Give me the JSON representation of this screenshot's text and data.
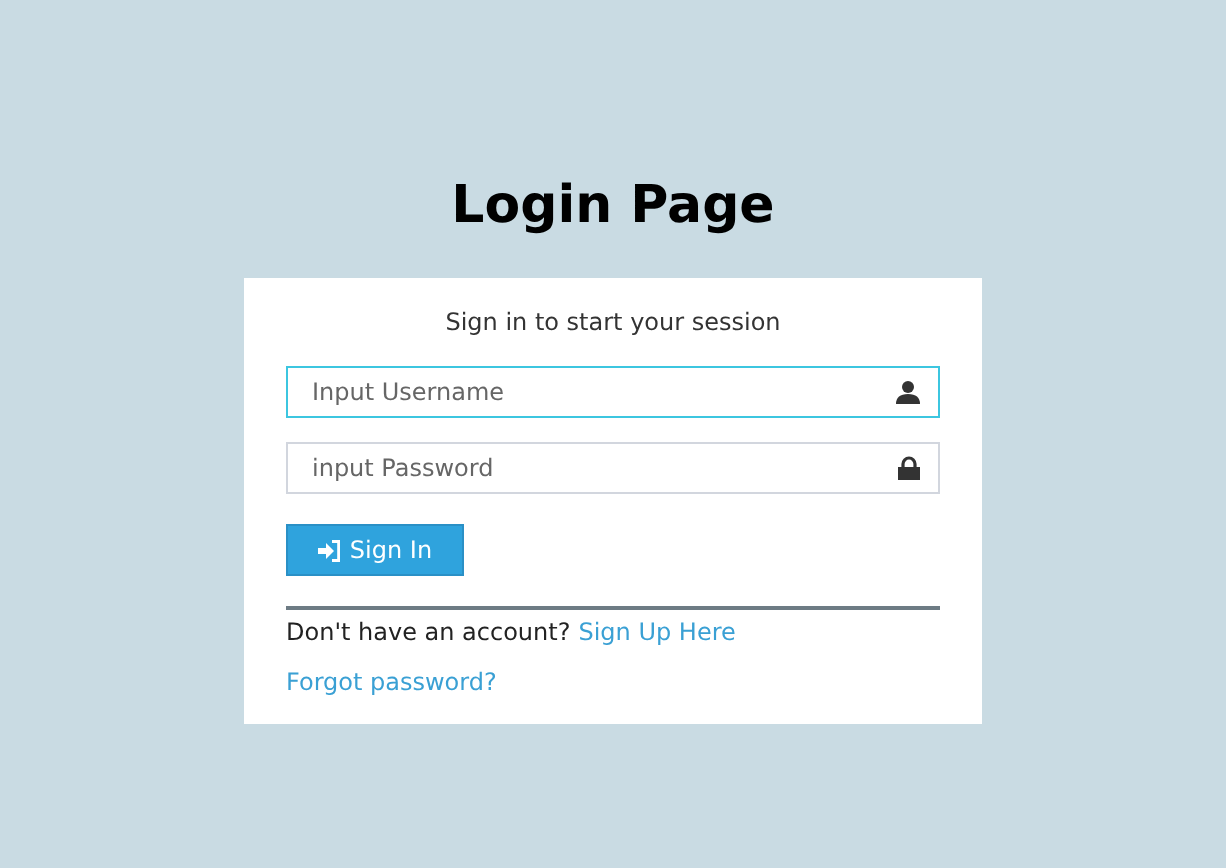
{
  "title": "Login Page",
  "card": {
    "message": "Sign in to start your session",
    "fields": [
      {
        "kind": "user",
        "placeholder": "Input Username",
        "focused": true
      },
      {
        "kind": "password",
        "placeholder": "input Password",
        "focused": false
      }
    ],
    "button": "Sign In",
    "signup_prompt": "Don't have an account?",
    "signup_link": "Sign Up Here",
    "forgot_link": "Forgot password?"
  }
}
